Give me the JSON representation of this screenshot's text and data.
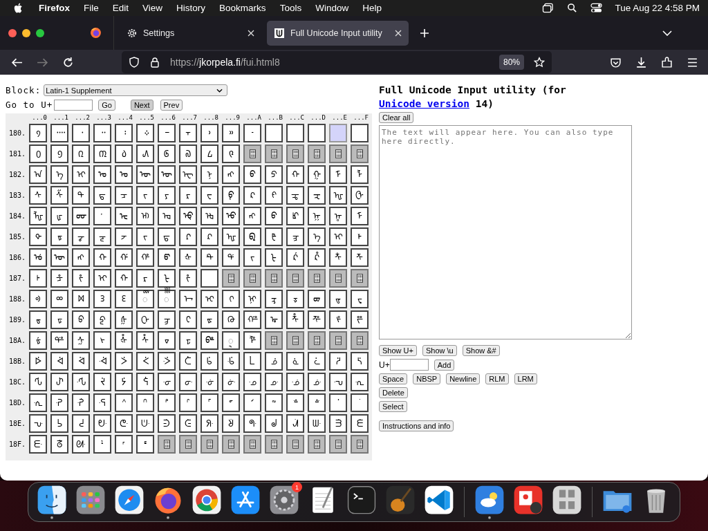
{
  "menu_bar": {
    "app": "Firefox",
    "items": [
      "File",
      "Edit",
      "View",
      "History",
      "Bookmarks",
      "Tools",
      "Window",
      "Help"
    ],
    "clock": "Tue Aug 22  4:58 PM"
  },
  "tabs": [
    {
      "title": "Settings",
      "kind": "settings",
      "selected": false
    },
    {
      "title": "Full Unicode Input utility",
      "kind": "page",
      "selected": true
    }
  ],
  "toolbar": {
    "url_scheme": "https://",
    "url_domain": "jkorpela.fi",
    "url_path": "/fui.html8",
    "zoom": "80%"
  },
  "page": {
    "block_label": "Block:",
    "block_value": "Latin-1 Supplement",
    "goto_label": "Go to U+",
    "goto_buttons": [
      "Go",
      "Next",
      "Prev"
    ],
    "columns": [
      "...0",
      "...1",
      "...2",
      "...3",
      "...4",
      "...5",
      "...6",
      "...7",
      "...8",
      "...9",
      "...A",
      "...B",
      "...C",
      "...D",
      "...E",
      "...F"
    ],
    "rows": [
      {
        "label": "180.",
        "cells": [
          {
            "kind": "char",
            "text": "᠀"
          },
          {
            "kind": "char",
            "text": "᠁"
          },
          {
            "kind": "char",
            "text": "᠂"
          },
          {
            "kind": "char",
            "text": "᠃"
          },
          {
            "kind": "char",
            "text": "᠄"
          },
          {
            "kind": "char",
            "text": "᠅"
          },
          {
            "kind": "char",
            "text": "᠆"
          },
          {
            "kind": "char",
            "text": "᠇"
          },
          {
            "kind": "char",
            "text": "᠈"
          },
          {
            "kind": "char",
            "text": "᠉"
          },
          {
            "kind": "char",
            "text": "᠊"
          },
          {
            "kind": "blank"
          },
          {
            "kind": "blank"
          },
          {
            "kind": "blank"
          },
          {
            "kind": "space"
          },
          {
            "kind": "blank"
          }
        ]
      },
      {
        "label": "181.",
        "cells": [
          {
            "kind": "char",
            "text": "᠐"
          },
          {
            "kind": "char",
            "text": "᠑"
          },
          {
            "kind": "char",
            "text": "᠒"
          },
          {
            "kind": "char",
            "text": "᠓"
          },
          {
            "kind": "char",
            "text": "᠔"
          },
          {
            "kind": "char",
            "text": "᠕"
          },
          {
            "kind": "char",
            "text": "᠖"
          },
          {
            "kind": "char",
            "text": "᠗"
          },
          {
            "kind": "char",
            "text": "᠘"
          },
          {
            "kind": "char",
            "text": "᠙"
          },
          {
            "kind": "unassigned"
          },
          {
            "kind": "unassigned"
          },
          {
            "kind": "unassigned"
          },
          {
            "kind": "unassigned"
          },
          {
            "kind": "unassigned"
          },
          {
            "kind": "unassigned"
          }
        ]
      },
      {
        "label": "182.",
        "cells": [
          {
            "kind": "char",
            "text": "ᠠ"
          },
          {
            "kind": "char",
            "text": "ᠡ"
          },
          {
            "kind": "char",
            "text": "ᠢ"
          },
          {
            "kind": "char",
            "text": "ᠣ"
          },
          {
            "kind": "char",
            "text": "ᠤ"
          },
          {
            "kind": "char",
            "text": "ᠥ"
          },
          {
            "kind": "char",
            "text": "ᠦ"
          },
          {
            "kind": "char",
            "text": "ᠧ"
          },
          {
            "kind": "char",
            "text": "ᠨ"
          },
          {
            "kind": "char",
            "text": "ᠩ"
          },
          {
            "kind": "char",
            "text": "ᠪ"
          },
          {
            "kind": "char",
            "text": "ᠫ"
          },
          {
            "kind": "char",
            "text": "ᠬ"
          },
          {
            "kind": "char",
            "text": "ᠭ"
          },
          {
            "kind": "char",
            "text": "ᠮ"
          },
          {
            "kind": "char",
            "text": "ᠯ"
          }
        ]
      },
      {
        "label": "183.",
        "cells": [
          {
            "kind": "char",
            "text": "ᠰ"
          },
          {
            "kind": "char",
            "text": "ᠱ"
          },
          {
            "kind": "char",
            "text": "ᠲ"
          },
          {
            "kind": "char",
            "text": "ᠳ"
          },
          {
            "kind": "char",
            "text": "ᠴ"
          },
          {
            "kind": "char",
            "text": "ᠵ"
          },
          {
            "kind": "char",
            "text": "ᠶ"
          },
          {
            "kind": "char",
            "text": "ᠷ"
          },
          {
            "kind": "char",
            "text": "ᠸ"
          },
          {
            "kind": "char",
            "text": "ᠹ"
          },
          {
            "kind": "char",
            "text": "ᠺ"
          },
          {
            "kind": "char",
            "text": "ᠻ"
          },
          {
            "kind": "char",
            "text": "ᠼ"
          },
          {
            "kind": "char",
            "text": "ᠽ"
          },
          {
            "kind": "char",
            "text": "ᠾ"
          },
          {
            "kind": "char",
            "text": "ᠿ"
          }
        ]
      },
      {
        "label": "184.",
        "cells": [
          {
            "kind": "char",
            "text": "ᡀ"
          },
          {
            "kind": "char",
            "text": "ᡁ"
          },
          {
            "kind": "char",
            "text": "ᡂ"
          },
          {
            "kind": "char",
            "text": "ᡃ"
          },
          {
            "kind": "char",
            "text": "ᡄ"
          },
          {
            "kind": "char",
            "text": "ᡅ"
          },
          {
            "kind": "char",
            "text": "ᡆ"
          },
          {
            "kind": "char",
            "text": "ᡇ"
          },
          {
            "kind": "char",
            "text": "ᡈ"
          },
          {
            "kind": "char",
            "text": "ᡉ"
          },
          {
            "kind": "char",
            "text": "ᡊ"
          },
          {
            "kind": "char",
            "text": "ᡋ"
          },
          {
            "kind": "char",
            "text": "ᡌ"
          },
          {
            "kind": "char",
            "text": "ᡍ"
          },
          {
            "kind": "char",
            "text": "ᡎ"
          },
          {
            "kind": "char",
            "text": "ᡏ"
          }
        ]
      },
      {
        "label": "185.",
        "cells": [
          {
            "kind": "char",
            "text": "ᡐ"
          },
          {
            "kind": "char",
            "text": "ᡑ"
          },
          {
            "kind": "char",
            "text": "ᡒ"
          },
          {
            "kind": "char",
            "text": "ᡓ"
          },
          {
            "kind": "char",
            "text": "ᡔ"
          },
          {
            "kind": "char",
            "text": "ᡕ"
          },
          {
            "kind": "char",
            "text": "ᡖ"
          },
          {
            "kind": "char",
            "text": "ᡗ"
          },
          {
            "kind": "char",
            "text": "ᡘ"
          },
          {
            "kind": "char",
            "text": "ᡙ"
          },
          {
            "kind": "char",
            "text": "ᡚ"
          },
          {
            "kind": "char",
            "text": "ᡛ"
          },
          {
            "kind": "char",
            "text": "ᡜ"
          },
          {
            "kind": "char",
            "text": "ᡝ"
          },
          {
            "kind": "char",
            "text": "ᡞ"
          },
          {
            "kind": "char",
            "text": "ᡟ"
          }
        ]
      },
      {
        "label": "186.",
        "cells": [
          {
            "kind": "char",
            "text": "ᡠ"
          },
          {
            "kind": "char",
            "text": "ᡡ"
          },
          {
            "kind": "char",
            "text": "ᡢ"
          },
          {
            "kind": "char",
            "text": "ᡣ"
          },
          {
            "kind": "char",
            "text": "ᡤ"
          },
          {
            "kind": "char",
            "text": "ᡥ"
          },
          {
            "kind": "char",
            "text": "ᡦ"
          },
          {
            "kind": "char",
            "text": "ᡧ"
          },
          {
            "kind": "char",
            "text": "ᡨ"
          },
          {
            "kind": "char",
            "text": "ᡩ"
          },
          {
            "kind": "char",
            "text": "ᡪ"
          },
          {
            "kind": "char",
            "text": "ᡫ"
          },
          {
            "kind": "char",
            "text": "ᡬ"
          },
          {
            "kind": "char",
            "text": "ᡭ"
          },
          {
            "kind": "char",
            "text": "ᡮ"
          },
          {
            "kind": "char",
            "text": "ᡯ"
          }
        ]
      },
      {
        "label": "187.",
        "cells": [
          {
            "kind": "char",
            "text": "ᡰ"
          },
          {
            "kind": "char",
            "text": "ᡱ"
          },
          {
            "kind": "char",
            "text": "ᡲ"
          },
          {
            "kind": "char",
            "text": "ᡳ"
          },
          {
            "kind": "char",
            "text": "ᡴ"
          },
          {
            "kind": "char",
            "text": "ᡵ"
          },
          {
            "kind": "char",
            "text": "ᡶ"
          },
          {
            "kind": "char",
            "text": "ᡷ"
          },
          {
            "kind": "blank"
          },
          {
            "kind": "unassigned"
          },
          {
            "kind": "unassigned"
          },
          {
            "kind": "unassigned"
          },
          {
            "kind": "unassigned"
          },
          {
            "kind": "unassigned"
          },
          {
            "kind": "unassigned"
          },
          {
            "kind": "unassigned"
          }
        ]
      },
      {
        "label": "188.",
        "cells": [
          {
            "kind": "char",
            "text": "ᢀ"
          },
          {
            "kind": "char",
            "text": "ᢁ"
          },
          {
            "kind": "char",
            "text": "ᢂ"
          },
          {
            "kind": "char",
            "text": "ᢃ"
          },
          {
            "kind": "char",
            "text": "ᢄ"
          },
          {
            "kind": "char",
            "text": "◌ᢅ"
          },
          {
            "kind": "char",
            "text": "◌ᢆ"
          },
          {
            "kind": "char",
            "text": "ᢇ"
          },
          {
            "kind": "char",
            "text": "ᢈ"
          },
          {
            "kind": "char",
            "text": "ᢉ"
          },
          {
            "kind": "char",
            "text": "ᢊ"
          },
          {
            "kind": "char",
            "text": "ᢋ"
          },
          {
            "kind": "char",
            "text": "ᢌ"
          },
          {
            "kind": "char",
            "text": "ᢍ"
          },
          {
            "kind": "char",
            "text": "ᢎ"
          },
          {
            "kind": "char",
            "text": "ᢏ"
          }
        ]
      },
      {
        "label": "189.",
        "cells": [
          {
            "kind": "char",
            "text": "ᢐ"
          },
          {
            "kind": "char",
            "text": "ᢑ"
          },
          {
            "kind": "char",
            "text": "ᢒ"
          },
          {
            "kind": "char",
            "text": "ᢓ"
          },
          {
            "kind": "char",
            "text": "ᢔ"
          },
          {
            "kind": "char",
            "text": "ᢕ"
          },
          {
            "kind": "char",
            "text": "ᢖ"
          },
          {
            "kind": "char",
            "text": "ᢗ"
          },
          {
            "kind": "char",
            "text": "ᢘ"
          },
          {
            "kind": "char",
            "text": "ᢙ"
          },
          {
            "kind": "char",
            "text": "ᢚ"
          },
          {
            "kind": "char",
            "text": "ᢛ"
          },
          {
            "kind": "char",
            "text": "ᢜ"
          },
          {
            "kind": "char",
            "text": "ᢝ"
          },
          {
            "kind": "char",
            "text": "ᢞ"
          },
          {
            "kind": "char",
            "text": "ᢟ"
          }
        ]
      },
      {
        "label": "18A.",
        "cells": [
          {
            "kind": "char",
            "text": "ᢠ"
          },
          {
            "kind": "char",
            "text": "ᢡ"
          },
          {
            "kind": "char",
            "text": "ᢢ"
          },
          {
            "kind": "char",
            "text": "ᢣ"
          },
          {
            "kind": "char",
            "text": "ᢤ"
          },
          {
            "kind": "char",
            "text": "ᢥ"
          },
          {
            "kind": "char",
            "text": "ᢦ"
          },
          {
            "kind": "char",
            "text": "ᢧ"
          },
          {
            "kind": "char",
            "text": "ᢨ"
          },
          {
            "kind": "char",
            "text": "◌ᢩ"
          },
          {
            "kind": "char",
            "text": "ᢪ"
          },
          {
            "kind": "unassigned"
          },
          {
            "kind": "unassigned"
          },
          {
            "kind": "unassigned"
          },
          {
            "kind": "unassigned"
          },
          {
            "kind": "unassigned"
          }
        ]
      },
      {
        "label": "18B.",
        "cells": [
          {
            "kind": "char",
            "text": "ᢰ"
          },
          {
            "kind": "char",
            "text": "ᢱ"
          },
          {
            "kind": "char",
            "text": "ᢲ"
          },
          {
            "kind": "char",
            "text": "ᢳ"
          },
          {
            "kind": "char",
            "text": "ᢴ"
          },
          {
            "kind": "char",
            "text": "ᢵ"
          },
          {
            "kind": "char",
            "text": "ᢶ"
          },
          {
            "kind": "char",
            "text": "ᢷ"
          },
          {
            "kind": "char",
            "text": "ᢸ"
          },
          {
            "kind": "char",
            "text": "ᢹ"
          },
          {
            "kind": "char",
            "text": "ᢺ"
          },
          {
            "kind": "char",
            "text": "ᢻ"
          },
          {
            "kind": "char",
            "text": "ᢼ"
          },
          {
            "kind": "char",
            "text": "ᢽ"
          },
          {
            "kind": "char",
            "text": "ᢾ"
          },
          {
            "kind": "char",
            "text": "ᢿ"
          }
        ]
      },
      {
        "label": "18C.",
        "cells": [
          {
            "kind": "char",
            "text": "ᣀ"
          },
          {
            "kind": "char",
            "text": "ᣁ"
          },
          {
            "kind": "char",
            "text": "ᣂ"
          },
          {
            "kind": "char",
            "text": "ᣃ"
          },
          {
            "kind": "char",
            "text": "ᣄ"
          },
          {
            "kind": "char",
            "text": "ᣅ"
          },
          {
            "kind": "char",
            "text": "ᣆ"
          },
          {
            "kind": "char",
            "text": "ᣇ"
          },
          {
            "kind": "char",
            "text": "ᣈ"
          },
          {
            "kind": "char",
            "text": "ᣉ"
          },
          {
            "kind": "char",
            "text": "ᣊ"
          },
          {
            "kind": "char",
            "text": "ᣋ"
          },
          {
            "kind": "char",
            "text": "ᣌ"
          },
          {
            "kind": "char",
            "text": "ᣍ"
          },
          {
            "kind": "char",
            "text": "ᣎ"
          },
          {
            "kind": "char",
            "text": "ᣏ"
          }
        ]
      },
      {
        "label": "18D.",
        "cells": [
          {
            "kind": "char",
            "text": "ᣐ"
          },
          {
            "kind": "char",
            "text": "ᣑ"
          },
          {
            "kind": "char",
            "text": "ᣒ"
          },
          {
            "kind": "char",
            "text": "ᣓ"
          },
          {
            "kind": "char",
            "text": "ᣔ"
          },
          {
            "kind": "char",
            "text": "ᣕ"
          },
          {
            "kind": "char",
            "text": "ᣖ"
          },
          {
            "kind": "char",
            "text": "ᣗ"
          },
          {
            "kind": "char",
            "text": "ᣘ"
          },
          {
            "kind": "char",
            "text": "ᣙ"
          },
          {
            "kind": "char",
            "text": "ᣚ"
          },
          {
            "kind": "char",
            "text": "ᣛ"
          },
          {
            "kind": "char",
            "text": "ᣜ"
          },
          {
            "kind": "char",
            "text": "ᣝ"
          },
          {
            "kind": "char",
            "text": "ᣞ"
          },
          {
            "kind": "char",
            "text": "ᣟ"
          }
        ]
      },
      {
        "label": "18E.",
        "cells": [
          {
            "kind": "char",
            "text": "ᣠ"
          },
          {
            "kind": "char",
            "text": "ᣡ"
          },
          {
            "kind": "char",
            "text": "ᣢ"
          },
          {
            "kind": "char",
            "text": "ᣣ"
          },
          {
            "kind": "char",
            "text": "ᣤ"
          },
          {
            "kind": "char",
            "text": "ᣥ"
          },
          {
            "kind": "char",
            "text": "ᣦ"
          },
          {
            "kind": "char",
            "text": "ᣧ"
          },
          {
            "kind": "char",
            "text": "ᣨ"
          },
          {
            "kind": "char",
            "text": "ᣩ"
          },
          {
            "kind": "char",
            "text": "ᣪ"
          },
          {
            "kind": "char",
            "text": "ᣫ"
          },
          {
            "kind": "char",
            "text": "ᣬ"
          },
          {
            "kind": "char",
            "text": "ᣭ"
          },
          {
            "kind": "char",
            "text": "ᣮ"
          },
          {
            "kind": "char",
            "text": "ᣯ"
          }
        ]
      },
      {
        "label": "18F.",
        "cells": [
          {
            "kind": "char",
            "text": "ᣰ"
          },
          {
            "kind": "char",
            "text": "ᣱ"
          },
          {
            "kind": "char",
            "text": "ᣲ"
          },
          {
            "kind": "char",
            "text": "ᣳ"
          },
          {
            "kind": "char",
            "text": "ᣴ"
          },
          {
            "kind": "char",
            "text": "ᣵ"
          },
          {
            "kind": "unassigned"
          },
          {
            "kind": "unassigned"
          },
          {
            "kind": "unassigned"
          },
          {
            "kind": "unassigned"
          },
          {
            "kind": "unassigned"
          },
          {
            "kind": "unassigned"
          },
          {
            "kind": "unassigned"
          },
          {
            "kind": "unassigned"
          },
          {
            "kind": "unassigned"
          },
          {
            "kind": "unassigned"
          }
        ]
      }
    ],
    "title_before": "Full Unicode Input utility (for ",
    "title_link": "Unicode version",
    "title_after": " 14)",
    "clear_button": "Clear all",
    "text_placeholder": "The text will appear here. You can also type here directly.",
    "show_buttons": [
      "Show U+",
      "Show \\u",
      "Show &#"
    ],
    "add_label": "U+",
    "add_button": "Add",
    "insert_buttons": [
      "Space",
      "NBSP",
      "Newline",
      "RLM",
      "LRM"
    ],
    "delete_button": "Delete",
    "select_button": "Select",
    "info_button": "Instructions and info"
  },
  "dock": [
    [
      {
        "kind": "finder",
        "running": true
      },
      {
        "kind": "launchpad",
        "running": false
      },
      {
        "kind": "safari",
        "running": false
      },
      {
        "kind": "firefox",
        "running": true
      },
      {
        "kind": "chrome",
        "running": false
      },
      {
        "kind": "appstore",
        "running": false
      },
      {
        "kind": "settings",
        "running": false,
        "badge": "1"
      },
      {
        "kind": "textedit",
        "running": false
      },
      {
        "kind": "terminal",
        "running": false
      },
      {
        "kind": "guitar",
        "running": false
      },
      {
        "kind": "vscode",
        "running": false
      }
    ],
    [
      {
        "kind": "weather",
        "running": true
      },
      {
        "kind": "photobooth",
        "running": false
      },
      {
        "kind": "fontbook",
        "running": false
      }
    ],
    [
      {
        "kind": "folder",
        "running": false
      },
      {
        "kind": "trash",
        "running": false
      }
    ]
  ]
}
